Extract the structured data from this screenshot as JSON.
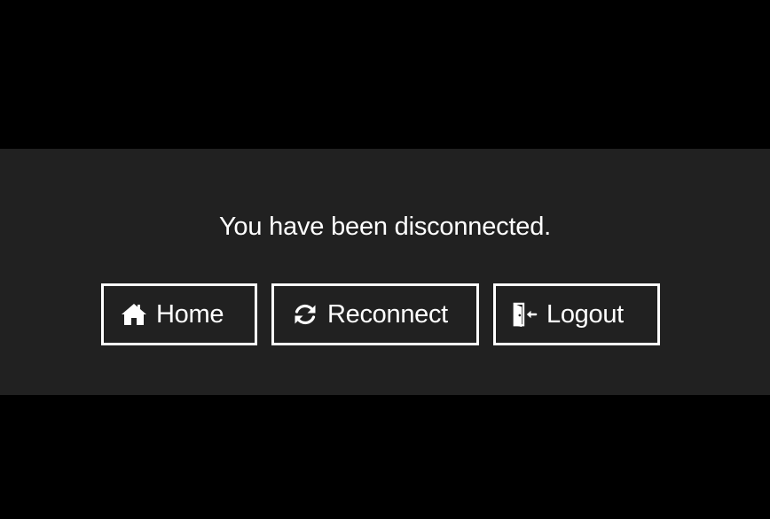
{
  "message": "You have been disconnected.",
  "buttons": {
    "home": {
      "label": "Home",
      "icon": "home-icon"
    },
    "reconnect": {
      "label": "Reconnect",
      "icon": "refresh-icon"
    },
    "logout": {
      "label": "Logout",
      "icon": "logout-door-icon"
    }
  },
  "colors": {
    "page_background": "#000000",
    "panel_background": "#212121",
    "foreground": "#ffffff"
  }
}
